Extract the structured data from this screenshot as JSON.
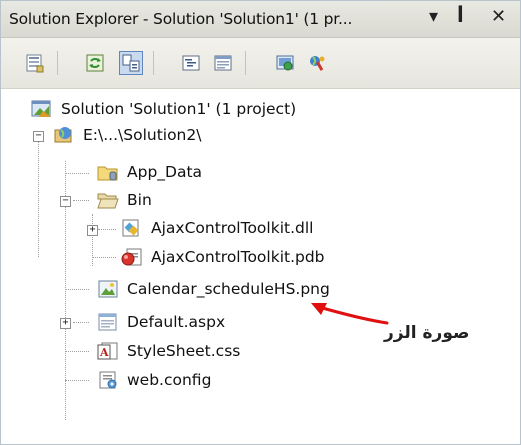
{
  "titlebar": {
    "title": "Solution Explorer - Solution 'Solution1' (1 pr...",
    "dropdown_glyph": "▾",
    "pin_glyph": "ꟾ",
    "close_glyph": "✕"
  },
  "toolbar": {
    "buttons": [
      {
        "icon": "properties-icon"
      },
      {
        "icon": "refresh-icon"
      },
      {
        "icon": "nest-related-files-icon",
        "active": true
      },
      {
        "icon": "view-code-icon"
      },
      {
        "icon": "view-designer-icon"
      },
      {
        "icon": "website-administration-icon"
      },
      {
        "icon": "aspnet-configuration-icon"
      }
    ]
  },
  "tree": {
    "solution": "Solution 'Solution1' (1 project)",
    "project": "E:\\...\\Solution2\\",
    "items": {
      "app_data": "App_Data",
      "bin": "Bin",
      "dll": "AjaxControlToolkit.dll",
      "pdb": "AjaxControlToolkit.pdb",
      "calendar": "Calendar_scheduleHS.png",
      "default": "Default.aspx",
      "stylesheet": "StyleSheet.css",
      "webconfig": "web.config"
    }
  },
  "annotation": {
    "text": "صورة الزر",
    "color": "#e01010"
  }
}
